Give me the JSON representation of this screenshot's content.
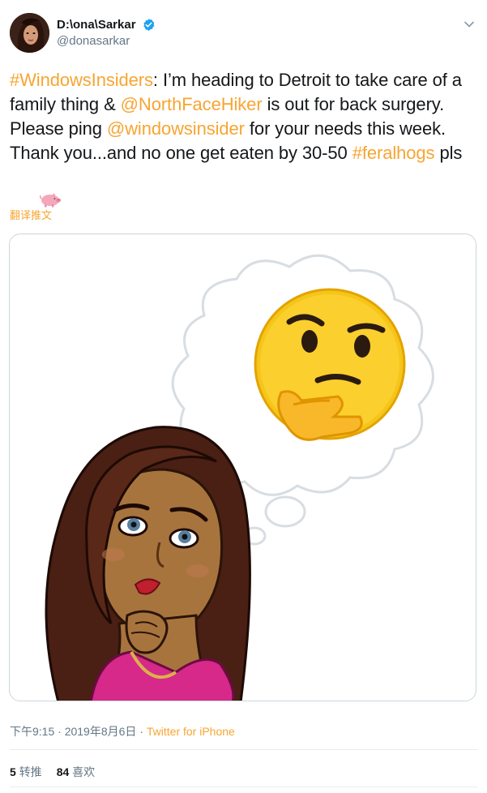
{
  "user": {
    "display_name": "D:\\ona\\Sarkar",
    "handle": "@donasarkar",
    "verified_icon": "verified-badge-icon",
    "menu_icon": "chevron-down-icon"
  },
  "tweet": {
    "parts": [
      {
        "text": "#WindowsInsiders",
        "type": "link"
      },
      {
        "text": ": I’m heading to Detroit to take care of a family thing & ",
        "type": "text"
      },
      {
        "text": "@NorthFaceHiker",
        "type": "link"
      },
      {
        "text": " is out for back surgery. Please ping ",
        "type": "text"
      },
      {
        "text": "@windowsinsider",
        "type": "link"
      },
      {
        "text": " for your needs this week. Thank you...and no one get eaten by 30-50 ",
        "type": "text"
      },
      {
        "text": "#feralhogs",
        "type": "link"
      },
      {
        "text": " pls ",
        "type": "text"
      }
    ],
    "emoji_icon": "pig-icon",
    "translate_label": "翻译推文"
  },
  "media": {
    "image_icon": "bitmoji-thinking-image"
  },
  "meta": {
    "time": "下午9:15",
    "date": "2019年8月6日",
    "separator": "·",
    "source": "Twitter for iPhone"
  },
  "stats": {
    "retweet_count": "5",
    "retweet_label": "转推",
    "like_count": "84",
    "like_label": "喜欢"
  },
  "colors": {
    "link": "#f7a531",
    "text": "#14171a",
    "secondary": "#657786",
    "verified": "#1da1f2",
    "border": "#ccd6dd"
  }
}
